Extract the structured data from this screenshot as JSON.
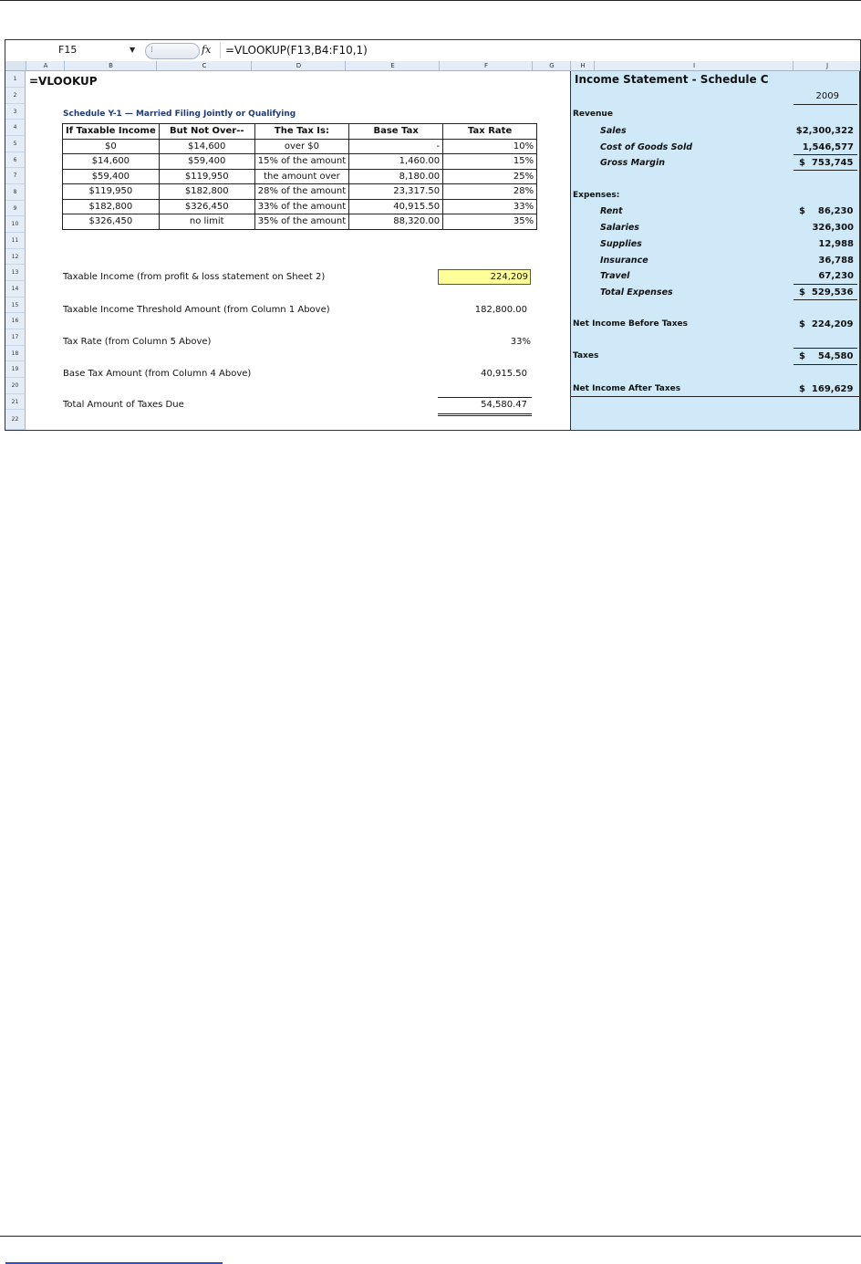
{
  "formula_bar": {
    "name_box": "F15",
    "fx": "fx",
    "formula": "=VLOOKUP(F13,B4:F10,1)"
  },
  "columns": [
    "A",
    "B",
    "C",
    "D",
    "E",
    "F",
    "G",
    "H",
    "I",
    "J"
  ],
  "rows": [
    "1",
    "2",
    "3",
    "4",
    "5",
    "6",
    "7",
    "8",
    "9",
    "10",
    "11",
    "12",
    "13",
    "14",
    "15",
    "16",
    "17",
    "18",
    "19",
    "20",
    "21",
    "22"
  ],
  "sheet": {
    "title": "=VLOOKUP",
    "schedule_title": "Schedule Y-1 — Married Filing Jointly or Qualifying",
    "table_headers": [
      "If Taxable Income",
      "But Not Over--",
      "The Tax Is:",
      "Base Tax",
      "Tax Rate"
    ],
    "table_rows": [
      {
        "b": "$0",
        "c": "$14,600",
        "d": "over $0",
        "e": "-",
        "f": "10%"
      },
      {
        "b": "$14,600",
        "c": "$59,400",
        "d": "15% of the amount",
        "e": "1,460.00",
        "f": "15%"
      },
      {
        "b": "$59,400",
        "c": "$119,950",
        "d": "the amount over",
        "e": "8,180.00",
        "f": "25%"
      },
      {
        "b": "$119,950",
        "c": "$182,800",
        "d": "28% of the amount",
        "e": "23,317.50",
        "f": "28%"
      },
      {
        "b": "$182,800",
        "c": "$326,450",
        "d": "33% of the amount",
        "e": "40,915.50",
        "f": "33%"
      },
      {
        "b": "$326,450",
        "c": "no limit",
        "d": "35% of the amount",
        "e": "88,320.00",
        "f": "35%"
      }
    ],
    "taxable_income_label": "Taxable Income (from profit & loss statement on Sheet 2)",
    "taxable_income_value": "224,209",
    "threshold_label": "Taxable Income Threshold Amount (from Column 1 Above)",
    "threshold_value": "182,800.00",
    "rate_label": "Tax Rate (from Column 5 Above)",
    "rate_value": "33%",
    "base_tax_label": "Base Tax Amount (from Column 4 Above)",
    "base_tax_value": "40,915.50",
    "total_label": "Total Amount of Taxes Due",
    "total_value": "54,580.47"
  },
  "income_statement": {
    "title": "Income Statement - Schedule C",
    "year": "2009",
    "revenue_label": "Revenue",
    "sales_label": "Sales",
    "sales_value": "$2,300,322",
    "cogs_label": "Cost of Goods Sold",
    "cogs_value": "1,546,577",
    "gross_margin_label": "Gross Margin",
    "gross_margin_value": "$  753,745",
    "expenses_label": "Expenses:",
    "rent_label": "Rent",
    "rent_value": "$    86,230",
    "salaries_label": "Salaries",
    "salaries_value": "326,300",
    "supplies_label": "Supplies",
    "supplies_value": "12,988",
    "insurance_label": "Insurance",
    "insurance_value": "36,788",
    "travel_label": "Travel",
    "travel_value": "67,230",
    "total_expenses_label": "Total Expenses",
    "total_expenses_value": "$  529,536",
    "nibt_label": "Net Income Before Taxes",
    "nibt_value": "$  224,209",
    "taxes_label": "Taxes",
    "taxes_value": "$    54,580",
    "niat_label": "Net Income After Taxes",
    "niat_value": "$  169,629"
  }
}
